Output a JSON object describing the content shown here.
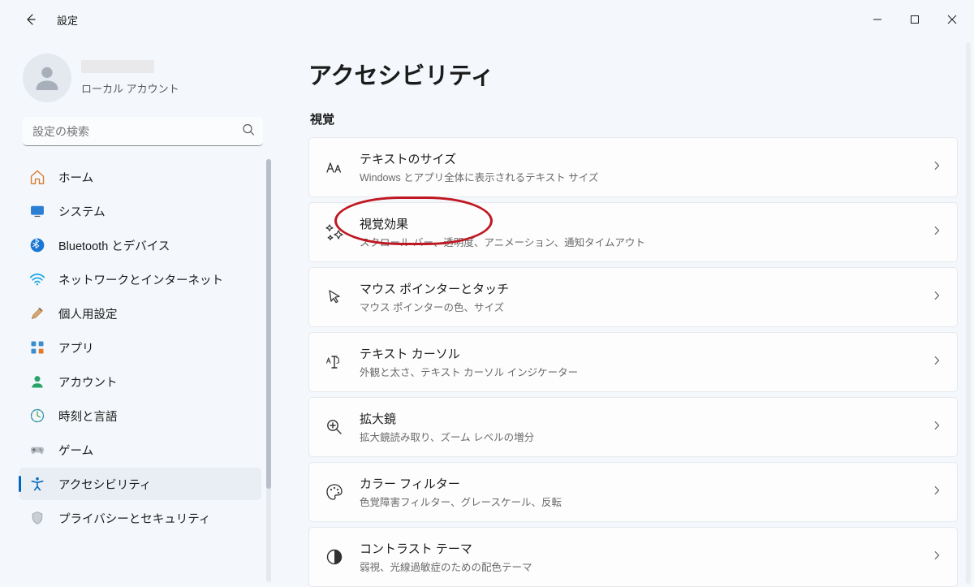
{
  "window": {
    "app_title": "設定"
  },
  "profile": {
    "account_type": "ローカル アカウント"
  },
  "search": {
    "placeholder": "設定の検索"
  },
  "sidebar": {
    "items": [
      {
        "label": "ホーム"
      },
      {
        "label": "システム"
      },
      {
        "label": "Bluetooth とデバイス"
      },
      {
        "label": "ネットワークとインターネット"
      },
      {
        "label": "個人用設定"
      },
      {
        "label": "アプリ"
      },
      {
        "label": "アカウント"
      },
      {
        "label": "時刻と言語"
      },
      {
        "label": "ゲーム"
      },
      {
        "label": "アクセシビリティ"
      },
      {
        "label": "プライバシーとセキュリティ"
      }
    ],
    "selected_index": 9
  },
  "main": {
    "title": "アクセシビリティ",
    "section": "視覚",
    "items": [
      {
        "title": "テキストのサイズ",
        "desc": "Windows とアプリ全体に表示されるテキスト サイズ"
      },
      {
        "title": "視覚効果",
        "desc": "スクロール バー、透明度、アニメーション、通知タイムアウト"
      },
      {
        "title": "マウス ポインターとタッチ",
        "desc": "マウス ポインターの色、サイズ"
      },
      {
        "title": "テキスト カーソル",
        "desc": "外観と太さ、テキスト カーソル インジケーター"
      },
      {
        "title": "拡大鏡",
        "desc": "拡大鏡読み取り、ズーム レベルの増分"
      },
      {
        "title": "カラー フィルター",
        "desc": "色覚障害フィルター、グレースケール、反転"
      },
      {
        "title": "コントラスト テーマ",
        "desc": "弱視、光線過敏症のための配色テーマ"
      }
    ],
    "highlight_index": 1
  }
}
